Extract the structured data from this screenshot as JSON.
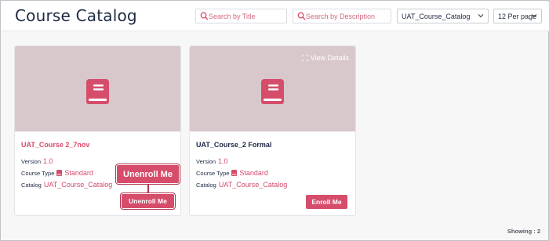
{
  "header": {
    "title": "Course Catalog",
    "search_title_placeholder": "Search by Title",
    "search_desc_placeholder": "Search by Description",
    "catalog_select": "UAT_Course_Catalog",
    "per_page_select": "12 Per page"
  },
  "cards": [
    {
      "title": "UAT_Course 2_7nov",
      "version_label": "Version",
      "version": "1.0",
      "type_label": "Course Type",
      "type": "Standard",
      "catalog_label": "Catalog",
      "catalog": "UAT_Course_Catalog",
      "callout_label": "Unenroll Me",
      "button_label": "Unenroll Me"
    },
    {
      "title": "UAT_Course_2 Formal",
      "view_details": "View Details",
      "version_label": "Version",
      "version": "1.0",
      "type_label": "Course Type",
      "type": "Standard",
      "catalog_label": "Catalog",
      "catalog": "UAT_Course_Catalog",
      "button_label": "Enroll Me"
    }
  ],
  "footer": {
    "showing": "Showing : 2"
  },
  "colors": {
    "accent": "#d64d6b",
    "thumb": "#d8c8cc",
    "title_text": "#1f2a44"
  }
}
